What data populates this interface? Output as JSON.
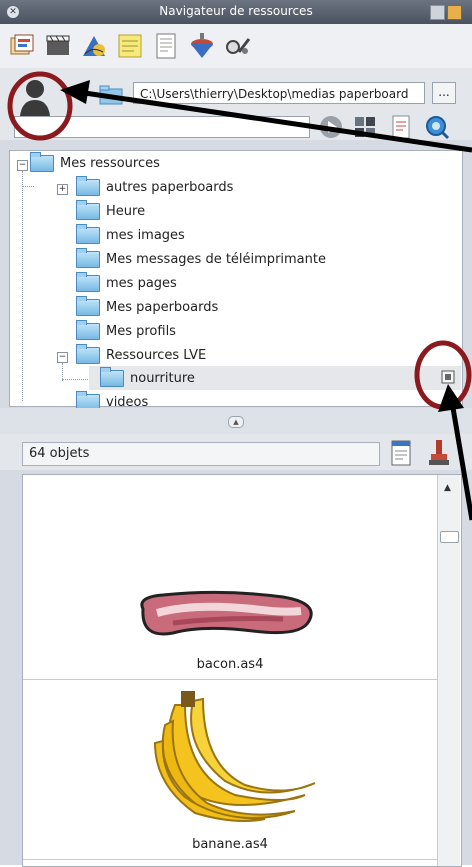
{
  "window": {
    "title": "Navigateur de ressources"
  },
  "toolbar": {
    "tools": [
      "paperboards-icon",
      "multimedia-icon",
      "shapes-icon",
      "notes-icon",
      "page-icon",
      "spinner-icon",
      "tools-icon"
    ]
  },
  "path": {
    "value": "C:\\Users\\thierry\\Desktop\\medias paperboard",
    "browse_label": "..."
  },
  "tree": {
    "root": "Mes ressources",
    "items": [
      "autres paperboards",
      "Heure",
      "mes images",
      "Mes messages de téléimprimante",
      "mes pages",
      "Mes paperboards",
      "Mes profils",
      "Ressources LVE",
      "nourriture",
      "videos"
    ]
  },
  "count": {
    "label": "64 objets"
  },
  "gallery": {
    "items": [
      {
        "caption": "bacon.as4"
      },
      {
        "caption": "banane.as4"
      }
    ]
  },
  "colors": {
    "annotation": "#8b1a1f",
    "folder": "#78b9e3",
    "titlebar": "#545c6a"
  }
}
